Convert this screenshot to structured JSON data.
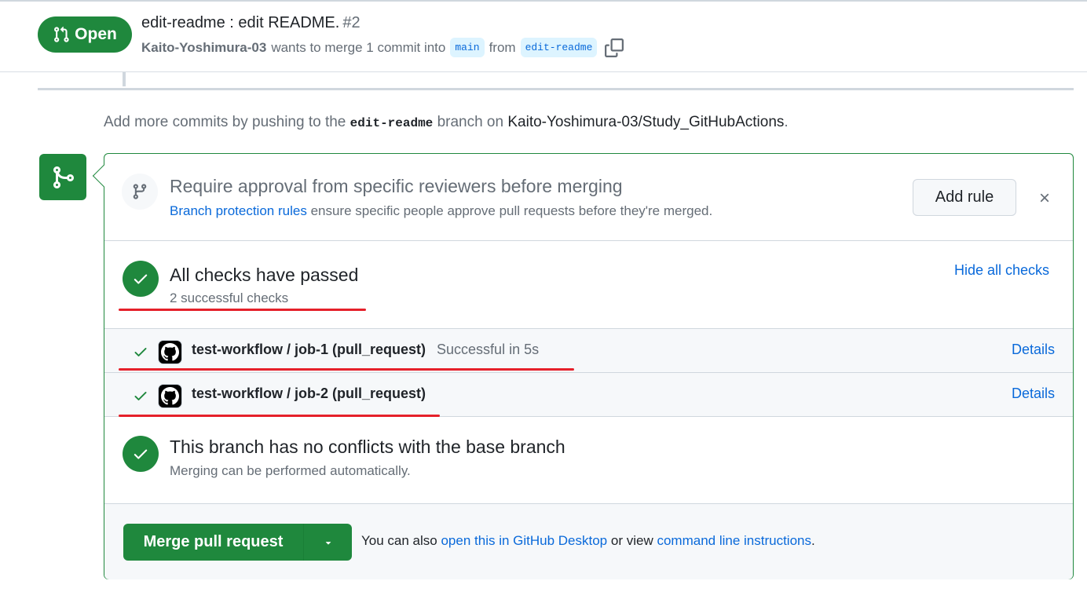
{
  "header": {
    "state": "Open",
    "title": "edit-readme : edit README.",
    "number": "#2",
    "author": "Kaito-Yoshimura-03",
    "merge_text_1": "wants to merge 1 commit into",
    "base_branch": "main",
    "merge_text_2": "from",
    "head_branch": "edit-readme"
  },
  "push_hint": {
    "prefix": "Add more commits by pushing to the",
    "branch": "edit-readme",
    "middle": "branch on",
    "repo": "Kaito-Yoshimura-03/Study_GitHubActions",
    "suffix": "."
  },
  "rule_prompt": {
    "title": "Require approval from specific reviewers before merging",
    "link": "Branch protection rules",
    "desc": "ensure specific people approve pull requests before they're merged.",
    "add_rule": "Add rule",
    "dismiss": "×"
  },
  "checks": {
    "title": "All checks have passed",
    "subtitle": "2 successful checks",
    "toggle": "Hide all checks",
    "items": [
      {
        "name": "test-workflow / job-1 (pull_request)",
        "status": "Successful in 5s",
        "details": "Details"
      },
      {
        "name": "test-workflow / job-2 (pull_request)",
        "status": "",
        "details": "Details"
      }
    ]
  },
  "conflicts": {
    "title": "This branch has no conflicts with the base branch",
    "subtitle": "Merging can be performed automatically."
  },
  "merge": {
    "button": "Merge pull request",
    "hint_prefix": "You can also",
    "desktop_link": "open this in GitHub Desktop",
    "hint_middle": "or view",
    "cli_link": "command line instructions",
    "hint_suffix": "."
  },
  "colors": {
    "success": "#1f883d",
    "link": "#0969da",
    "annotation": "#e5202a"
  }
}
